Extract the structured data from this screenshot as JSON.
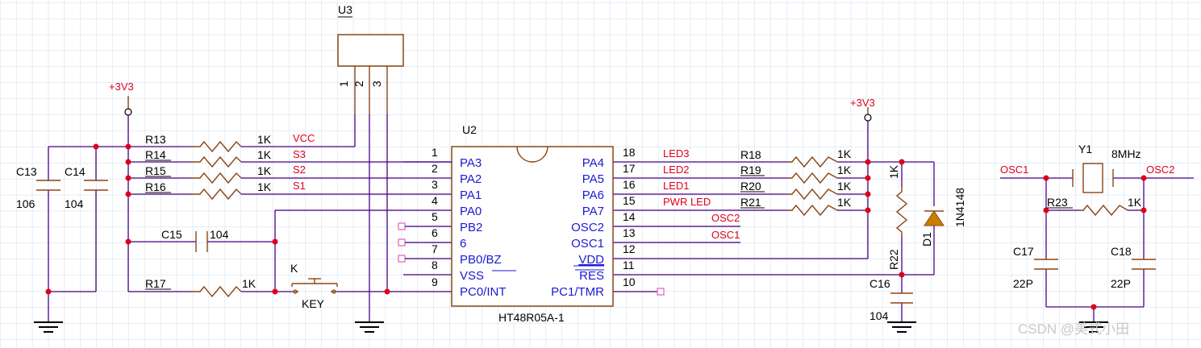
{
  "power_labels": {
    "vcc_left": "+3V3",
    "vcc_right": "+3V3"
  },
  "u3": {
    "ref": "U3",
    "pins": [
      "1",
      "2",
      "3"
    ]
  },
  "u2": {
    "ref": "U2",
    "part": "HT48R05A-1",
    "left_pin_numbers": [
      "1",
      "2",
      "3",
      "4",
      "5",
      "6",
      "7",
      "8",
      "9"
    ],
    "left_pin_names": [
      "PA3",
      "PA2",
      "PA1",
      "PA0",
      "PB2",
      "6",
      "PB0/BZ",
      "VSS",
      "PC0/INT"
    ],
    "right_pin_numbers": [
      "18",
      "17",
      "16",
      "15",
      "14",
      "13",
      "12",
      "11",
      "10"
    ],
    "right_pin_names": [
      "PA4",
      "PA5",
      "PA6",
      "PA7",
      "OSC2",
      "OSC1",
      "VDD",
      "RES",
      "PC1/TMR"
    ]
  },
  "left_resistors": [
    {
      "ref": "R13",
      "value": "1K",
      "net": "VCC"
    },
    {
      "ref": "R14",
      "value": "1K",
      "net": "S3"
    },
    {
      "ref": "R15",
      "value": "1K",
      "net": "S2"
    },
    {
      "ref": "R16",
      "value": "1K",
      "net": "S1"
    }
  ],
  "right_resistors": [
    {
      "ref": "R18",
      "value": "1K",
      "net": "LED3"
    },
    {
      "ref": "R19",
      "value": "1K",
      "net": "LED2"
    },
    {
      "ref": "R20",
      "value": "1K",
      "net": "LED1"
    },
    {
      "ref": "R21",
      "value": "1K",
      "net": "PWR LED"
    }
  ],
  "osc_nets": {
    "osc2": "OSC2",
    "osc1": "OSC1"
  },
  "capacitors": {
    "c13": {
      "ref": "C13",
      "value": "106"
    },
    "c14": {
      "ref": "C14",
      "value": "104"
    },
    "c15": {
      "ref": "C15",
      "value": "104"
    },
    "c16": {
      "ref": "C16",
      "value": "104"
    },
    "c17": {
      "ref": "C17",
      "value": "22P"
    },
    "c18": {
      "ref": "C18",
      "value": "22P"
    }
  },
  "r17": {
    "ref": "R17",
    "value": "1K"
  },
  "key": {
    "ref": "K",
    "value": "KEY"
  },
  "r22": {
    "ref": "R22",
    "value": "1K"
  },
  "d1": {
    "ref": "D1",
    "value": "1N4148"
  },
  "crystal": {
    "ref": "Y1",
    "value": "8MHz",
    "net_left": "OSC1",
    "net_right": "OSC2"
  },
  "r23": {
    "ref": "R23",
    "value": "1K"
  },
  "watermark": "CSDN @美式小田",
  "colors": {
    "wire": "#4b0082",
    "component": "#8b4513",
    "pin_text": "#1a1ad6",
    "net_label": "#e0001a",
    "grid": "#c9dcf2"
  }
}
